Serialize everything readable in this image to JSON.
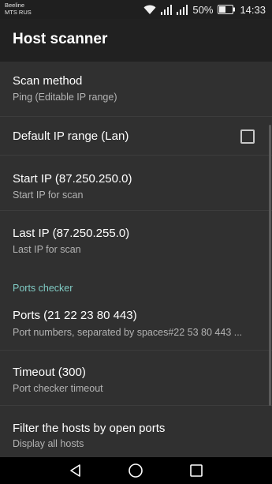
{
  "status": {
    "carrier_line1": "Beeline",
    "carrier_line2": "MTS RUS",
    "battery": "50%",
    "time": "14:33",
    "icons": [
      "wifi-icon",
      "signal-icon",
      "signal-icon",
      "battery-icon"
    ]
  },
  "app_bar": {
    "title": "Host scanner"
  },
  "prefs": {
    "scan_method": {
      "title": "Scan method",
      "summary": "Ping (Editable IP range)"
    },
    "default_ip_range": {
      "title": "Default IP range (Lan)",
      "checked": false
    },
    "start_ip": {
      "title": "Start IP (87.250.250.0)",
      "summary": "Start IP for scan"
    },
    "last_ip": {
      "title": "Last IP (87.250.255.0)",
      "summary": "Last IP for scan"
    },
    "ports_category": {
      "label": "Ports checker"
    },
    "ports": {
      "title": "Ports (21 22 23 80 443)",
      "summary": "Port numbers, separated by spaces#22 53 80 443 ..."
    },
    "timeout": {
      "title": "Timeout (300)",
      "summary": "Port checker timeout"
    },
    "filter_hosts": {
      "title": "Filter the hosts by open ports",
      "summary": "Display all hosts"
    }
  },
  "nav": {
    "icons": [
      "back-icon",
      "home-icon",
      "recents-icon"
    ]
  },
  "colors": {
    "accent": "#80cbc4",
    "background": "#303030",
    "app_bar": "#212121"
  }
}
